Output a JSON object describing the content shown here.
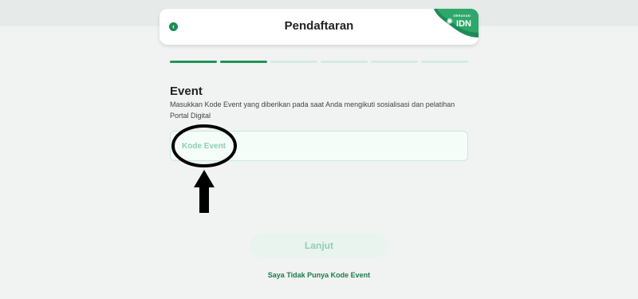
{
  "header": {
    "title": "Pendaftaran",
    "back_icon": "chevron-left-icon",
    "logo_text": "IDN",
    "logo_subtext": "GERAKAN",
    "accent_color": "#1e8a55"
  },
  "progress": {
    "total_steps": 6,
    "completed_steps": 2
  },
  "event_section": {
    "title": "Event",
    "description": "Masukkan Kode Event yang diberikan pada saat Anda mengikuti sosialisasi dan pelatihan Portal Digital",
    "input_placeholder": "Kode Event",
    "input_value": ""
  },
  "actions": {
    "next_label": "Lanjut",
    "no_code_link": "Saya Tidak Punya Kode Event"
  }
}
